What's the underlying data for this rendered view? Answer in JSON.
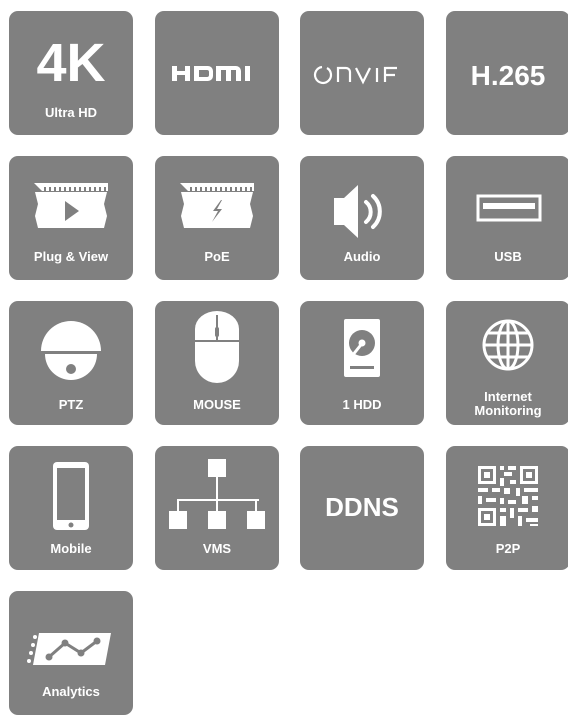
{
  "features": {
    "k4": {
      "big": "4K",
      "label": "Ultra HD"
    },
    "hdmi": {
      "big": "HDMI"
    },
    "onvif": {
      "big": "ONVIF"
    },
    "h265": {
      "big": "H.265"
    },
    "plug": {
      "label": "Plug & View"
    },
    "poe": {
      "label": "PoE"
    },
    "audio": {
      "label": "Audio"
    },
    "usb": {
      "label": "USB"
    },
    "ptz": {
      "label": "PTZ"
    },
    "mouse": {
      "label": "MOUSE"
    },
    "hdd": {
      "label": "1 HDD"
    },
    "internet": {
      "label_line1": "Internet",
      "label_line2": "Monitoring"
    },
    "mobile": {
      "label": "Mobile"
    },
    "vms": {
      "label": "VMS"
    },
    "ddns": {
      "big": "DDNS"
    },
    "p2p": {
      "label": "P2P"
    },
    "analytics": {
      "label": "Analytics"
    }
  },
  "colors": {
    "tile": "#808080",
    "icon": "#ffffff"
  }
}
